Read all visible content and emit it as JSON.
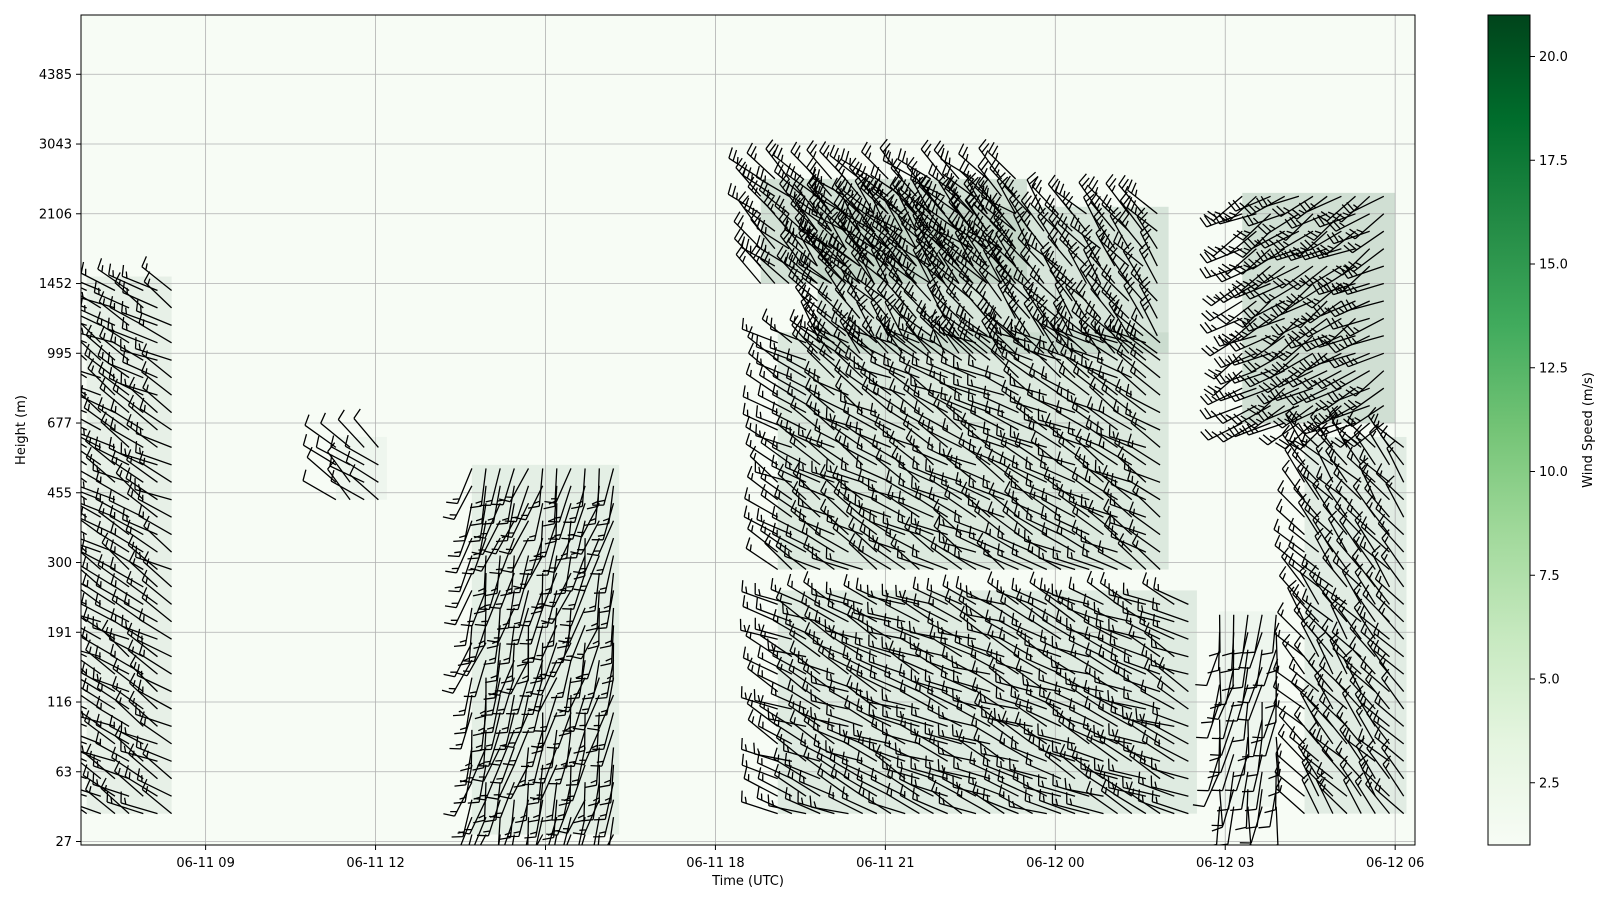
{
  "chart_data": {
    "type": "heatmap",
    "subtype": "wind barb profile (speed shaded, barbs for direction)",
    "title": "",
    "xlabel": "Time (UTC)",
    "ylabel": "Height (m)",
    "colorbar_label": "Wind Speed (m/s)",
    "colormap": "Greens",
    "color_min": "#f7fcf5",
    "color_max": "#00441b",
    "grid": true,
    "x_ticks": [
      "06-11 09",
      "06-11 12",
      "06-11 15",
      "06-11 18",
      "06-11 21",
      "06-12 00",
      "06-12 03",
      "06-12 06"
    ],
    "x_range_hours": [
      6.8,
      30.35
    ],
    "y_ticks": [
      "27",
      "63",
      "116",
      "191",
      "300",
      "455",
      "677",
      "995",
      "1452",
      "2106",
      "3043",
      "4385"
    ],
    "y_range_levels": [
      -0.05,
      11.85
    ],
    "colorbar_ticks": [
      2.5,
      5.0,
      7.5,
      10.0,
      12.5,
      15.0,
      17.5,
      20.0
    ],
    "colorbar_range": [
      1.0,
      21.0
    ],
    "wind_regions": [
      {
        "t_start": 6.9,
        "t_end": 8.4,
        "h_start": 0.4,
        "h_end": 8.1,
        "speed": 4.5,
        "direction_deg": 300
      },
      {
        "t_start": 11.3,
        "t_end": 12.2,
        "h_start": 4.9,
        "h_end": 5.8,
        "speed": 3.0,
        "direction_deg": 310
      },
      {
        "t_start": 13.7,
        "t_end": 16.3,
        "h_start": 0.1,
        "h_end": 5.4,
        "speed": 5.0,
        "direction_deg": 195
      },
      {
        "t_start": 19.1,
        "t_end": 26.0,
        "h_start": 3.9,
        "h_end": 7.3,
        "speed": 6.5,
        "direction_deg": 300
      },
      {
        "t_start": 19.1,
        "t_end": 26.5,
        "h_start": 0.4,
        "h_end": 3.6,
        "speed": 6.0,
        "direction_deg": 295
      },
      {
        "t_start": 19.8,
        "t_end": 26.0,
        "h_start": 7.0,
        "h_end": 9.1,
        "speed": 7.5,
        "direction_deg": 320
      },
      {
        "t_start": 18.8,
        "t_end": 23.5,
        "h_start": 8.0,
        "h_end": 9.5,
        "speed": 8.5,
        "direction_deg": 310
      },
      {
        "t_start": 27.3,
        "t_end": 30.0,
        "h_start": 6.0,
        "h_end": 9.3,
        "speed": 9.0,
        "direction_deg": 240
      },
      {
        "t_start": 28.4,
        "t_end": 30.2,
        "h_start": 0.4,
        "h_end": 5.8,
        "speed": 5.5,
        "direction_deg": 320
      },
      {
        "t_start": 26.9,
        "t_end": 27.9,
        "h_start": 0.5,
        "h_end": 3.3,
        "speed": 3.0,
        "direction_deg": 190
      }
    ]
  }
}
